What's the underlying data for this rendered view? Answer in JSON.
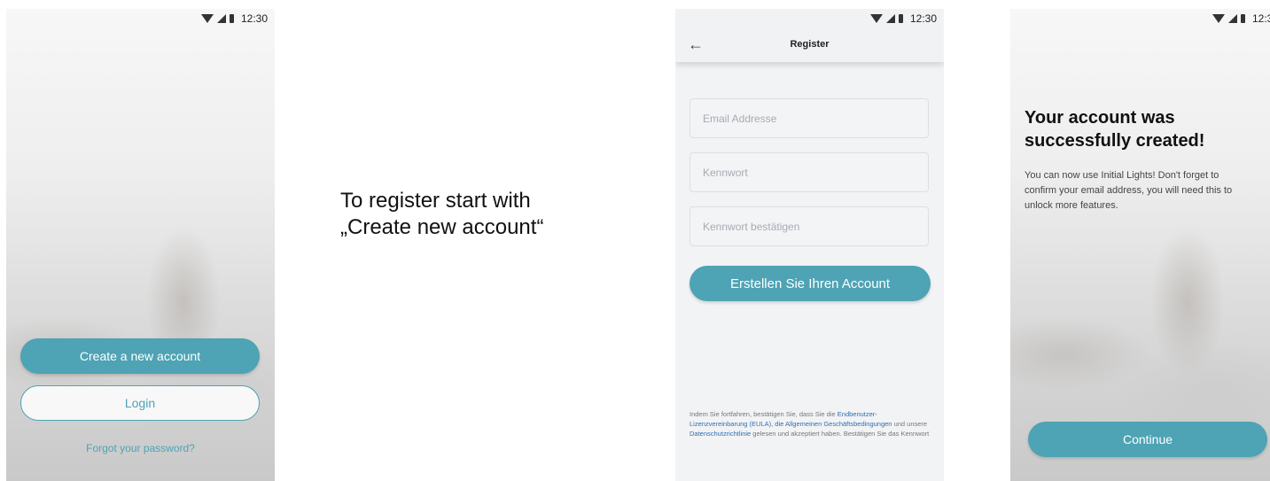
{
  "status": {
    "time": "12:30"
  },
  "screen1": {
    "create_account_label": "Create a new account",
    "login_label": "Login",
    "forgot_password_label": "Forgot your password?"
  },
  "caption": {
    "line1": "To register start with",
    "line2": "„Create new account“"
  },
  "screen2": {
    "title": "Register",
    "email_placeholder": "Email Addresse",
    "password_placeholder": "Kennwort",
    "confirm_placeholder": "Kennwort bestätigen",
    "submit_label": "Erstellen Sie Ihren Account",
    "terms": {
      "t1": "Indem Sie fortfahren, bestätigen Sie, dass Sie die ",
      "l1": "Endbenutzer-Lizenzvereinbarung (EULA), die Allgemeinen Geschäftsbedingungen",
      "t2": " und unsere ",
      "l2": "Datenschutzrichtlinie",
      "t3": " gelesen und akzeptiert haben. Bestätigen Sie das Kennwort"
    }
  },
  "screen3": {
    "title_line1": "Your account was",
    "title_line2": "successfully created!",
    "body": "You can now use Initial Lights! Don't forget to confirm your email address, you will need this to unlock more features.",
    "continue_label": "Continue"
  },
  "icons": {
    "wifi": "wifi-icon",
    "signal": "signal-icon",
    "battery": "battery-icon",
    "back": "back-arrow-icon"
  },
  "colors": {
    "accent": "#4ea3b4",
    "link": "#2f6fb0"
  }
}
